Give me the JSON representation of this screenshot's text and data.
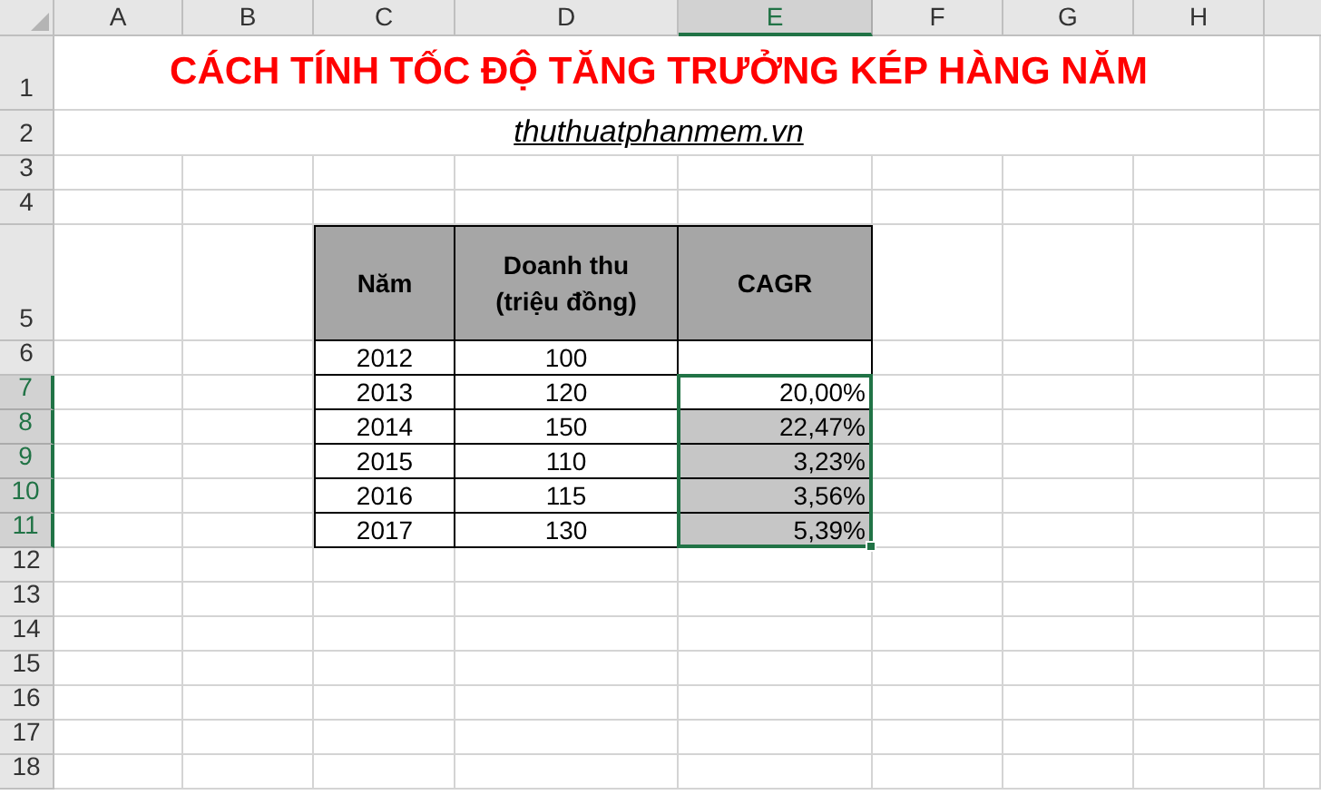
{
  "columns": [
    {
      "label": "A",
      "selected": false
    },
    {
      "label": "B",
      "selected": false
    },
    {
      "label": "C",
      "selected": false
    },
    {
      "label": "D",
      "selected": false
    },
    {
      "label": "E",
      "selected": true
    },
    {
      "label": "F",
      "selected": false
    },
    {
      "label": "G",
      "selected": false
    },
    {
      "label": "H",
      "selected": false
    }
  ],
  "rows": [
    {
      "label": "1",
      "selected": false
    },
    {
      "label": "2",
      "selected": false
    },
    {
      "label": "3",
      "selected": false
    },
    {
      "label": "4",
      "selected": false
    },
    {
      "label": "5",
      "selected": false
    },
    {
      "label": "6",
      "selected": false
    },
    {
      "label": "7",
      "selected": true
    },
    {
      "label": "8",
      "selected": true
    },
    {
      "label": "9",
      "selected": true
    },
    {
      "label": "10",
      "selected": true
    },
    {
      "label": "11",
      "selected": true
    },
    {
      "label": "12",
      "selected": false
    },
    {
      "label": "13",
      "selected": false
    },
    {
      "label": "14",
      "selected": false
    },
    {
      "label": "15",
      "selected": false
    },
    {
      "label": "16",
      "selected": false
    },
    {
      "label": "17",
      "selected": false
    },
    {
      "label": "18",
      "selected": false
    }
  ],
  "title": "CÁCH TÍNH TỐC ĐỘ TĂNG TRƯỞNG KÉP HÀNG NĂM",
  "subtitle": "thuthuatphanmem.vn",
  "table": {
    "headers": [
      "Năm",
      "Doanh thu (triệu đồng)",
      "CAGR"
    ],
    "rows": [
      {
        "year": "2012",
        "revenue": "100",
        "selected": false
      },
      {
        "year": "2013",
        "revenue": "120",
        "cagr": "20,00%",
        "selected": true
      },
      {
        "year": "2014",
        "revenue": "150",
        "cagr": "22,47%",
        "selected": true
      },
      {
        "year": "2015",
        "revenue": "110",
        "cagr": "3,23%",
        "selected": true
      },
      {
        "year": "2016",
        "revenue": "115",
        "cagr": "3,56%",
        "selected": true
      },
      {
        "year": "2017",
        "revenue": "130",
        "cagr": "5,39%",
        "selected": true
      }
    ]
  }
}
